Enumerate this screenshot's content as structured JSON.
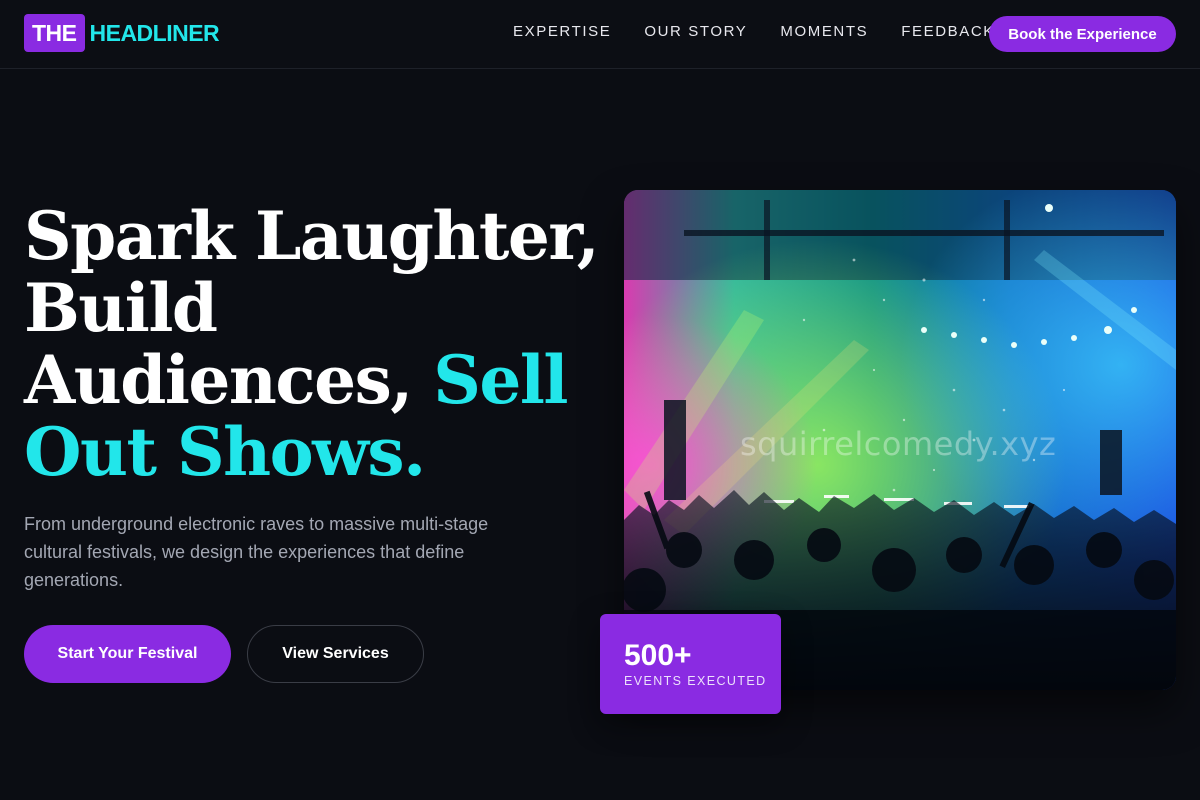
{
  "header": {
    "logo_box": "THE",
    "logo_text": "HEADLINER",
    "nav": [
      {
        "label": "EXPERTISE"
      },
      {
        "label": "OUR STORY"
      },
      {
        "label": "MOMENTS"
      },
      {
        "label": "FEEDBACK"
      }
    ],
    "cta_label": "Book the Experience"
  },
  "hero": {
    "title_part1": "Spark Laughter, Build Audiences, ",
    "title_accent": "Sell Out Shows.",
    "description": "From underground electronic raves to massive multi-stage cultural festivals, we design the experiences that define generations.",
    "primary_button": "Start Your Festival",
    "secondary_button": "View Services",
    "watermark": "squirrelcomedy.xyz",
    "stat_value": "500+",
    "stat_label": "EVENTS EXECUTED"
  },
  "colors": {
    "background": "#0b0d13",
    "brand_purple": "#8a2be2",
    "accent_cyan": "#22e6ea",
    "muted_text": "#a3a7b3"
  }
}
